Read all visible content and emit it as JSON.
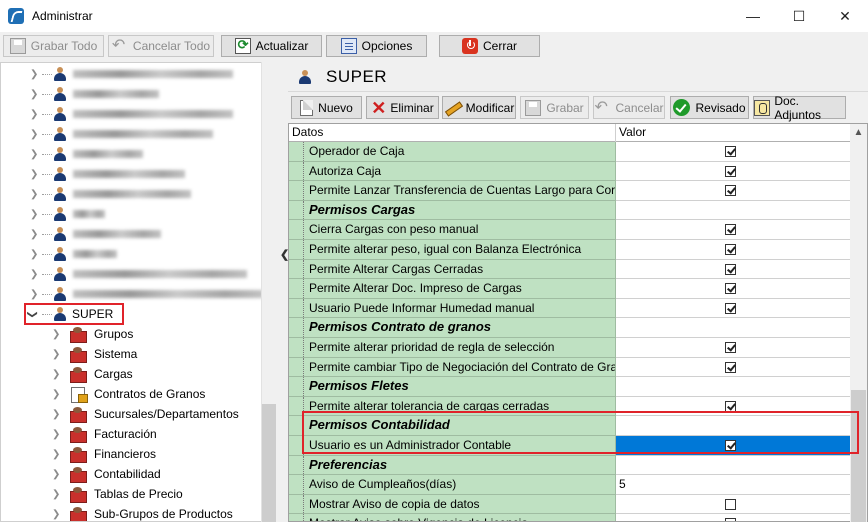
{
  "window": {
    "title": "Administrar"
  },
  "toolbar": {
    "save_label": "Grabar Todo",
    "cancel_label": "Cancelar Todo",
    "refresh_label": "Actualizar",
    "options_label": "Opciones",
    "close_label": "Cerrar"
  },
  "tree": {
    "selected_user": "SUPER",
    "groups": [
      "Grupos",
      "Sistema",
      "Cargas",
      "Contratos de Granos",
      "Sucursales/Departamentos",
      "Facturación",
      "Financieros",
      "Contabilidad",
      "Tablas de Precio",
      "Sub-Grupos de Productos"
    ]
  },
  "panel": {
    "title": "SUPER"
  },
  "actions": {
    "new_label": "Nuevo",
    "delete_label": "Eliminar",
    "edit_label": "Modificar",
    "save_label": "Grabar",
    "cancel_label": "Cancelar",
    "reviewed_label": "Revisado",
    "attachments_label": "Doc. Adjuntos"
  },
  "grid": {
    "columns": [
      "Datos",
      "Valor"
    ],
    "rows": [
      {
        "label": "Operador de Caja",
        "type": "check",
        "checked": true
      },
      {
        "label": "Autoriza Caja",
        "type": "check",
        "checked": true
      },
      {
        "label": "Permite Lanzar Transferencia de Cuentas Largo para Corto",
        "type": "check",
        "checked": true
      },
      {
        "label": "Permisos Cargas",
        "type": "category"
      },
      {
        "label": "Cierra Cargas con peso manual",
        "type": "check",
        "checked": true
      },
      {
        "label": "Permite alterar peso, igual con Balanza Electrónica",
        "type": "check",
        "checked": true
      },
      {
        "label": "Permite Alterar Cargas Cerradas",
        "type": "check",
        "checked": true
      },
      {
        "label": "Permite Alterar Doc. Impreso de Cargas",
        "type": "check",
        "checked": true
      },
      {
        "label": "Usuario Puede Informar Humedad manual",
        "type": "check",
        "checked": true
      },
      {
        "label": "Permisos Contrato de granos",
        "type": "category"
      },
      {
        "label": "Permite alterar prioridad de regla de selección",
        "type": "check",
        "checked": true
      },
      {
        "label": "Permite cambiar Tipo de Negociación del Contrato de Granos",
        "type": "check",
        "checked": true
      },
      {
        "label": "Permisos Fletes",
        "type": "category"
      },
      {
        "label": "Permite alterar tolerancia de cargas cerradas",
        "type": "check",
        "checked": true
      },
      {
        "label": "Permisos Contabilidad",
        "type": "category"
      },
      {
        "label": "Usuario es un Administrador Contable",
        "type": "check",
        "checked": true,
        "selected": true
      },
      {
        "label": "Preferencias",
        "type": "category"
      },
      {
        "label": "Aviso de Cumpleaños(días)",
        "type": "text",
        "value": "5"
      },
      {
        "label": "Mostrar Aviso de copia de datos",
        "type": "check",
        "checked": false
      },
      {
        "label": "Mostrar Aviso sobre Vigencia de Licencia",
        "type": "check",
        "checked": false
      }
    ]
  }
}
